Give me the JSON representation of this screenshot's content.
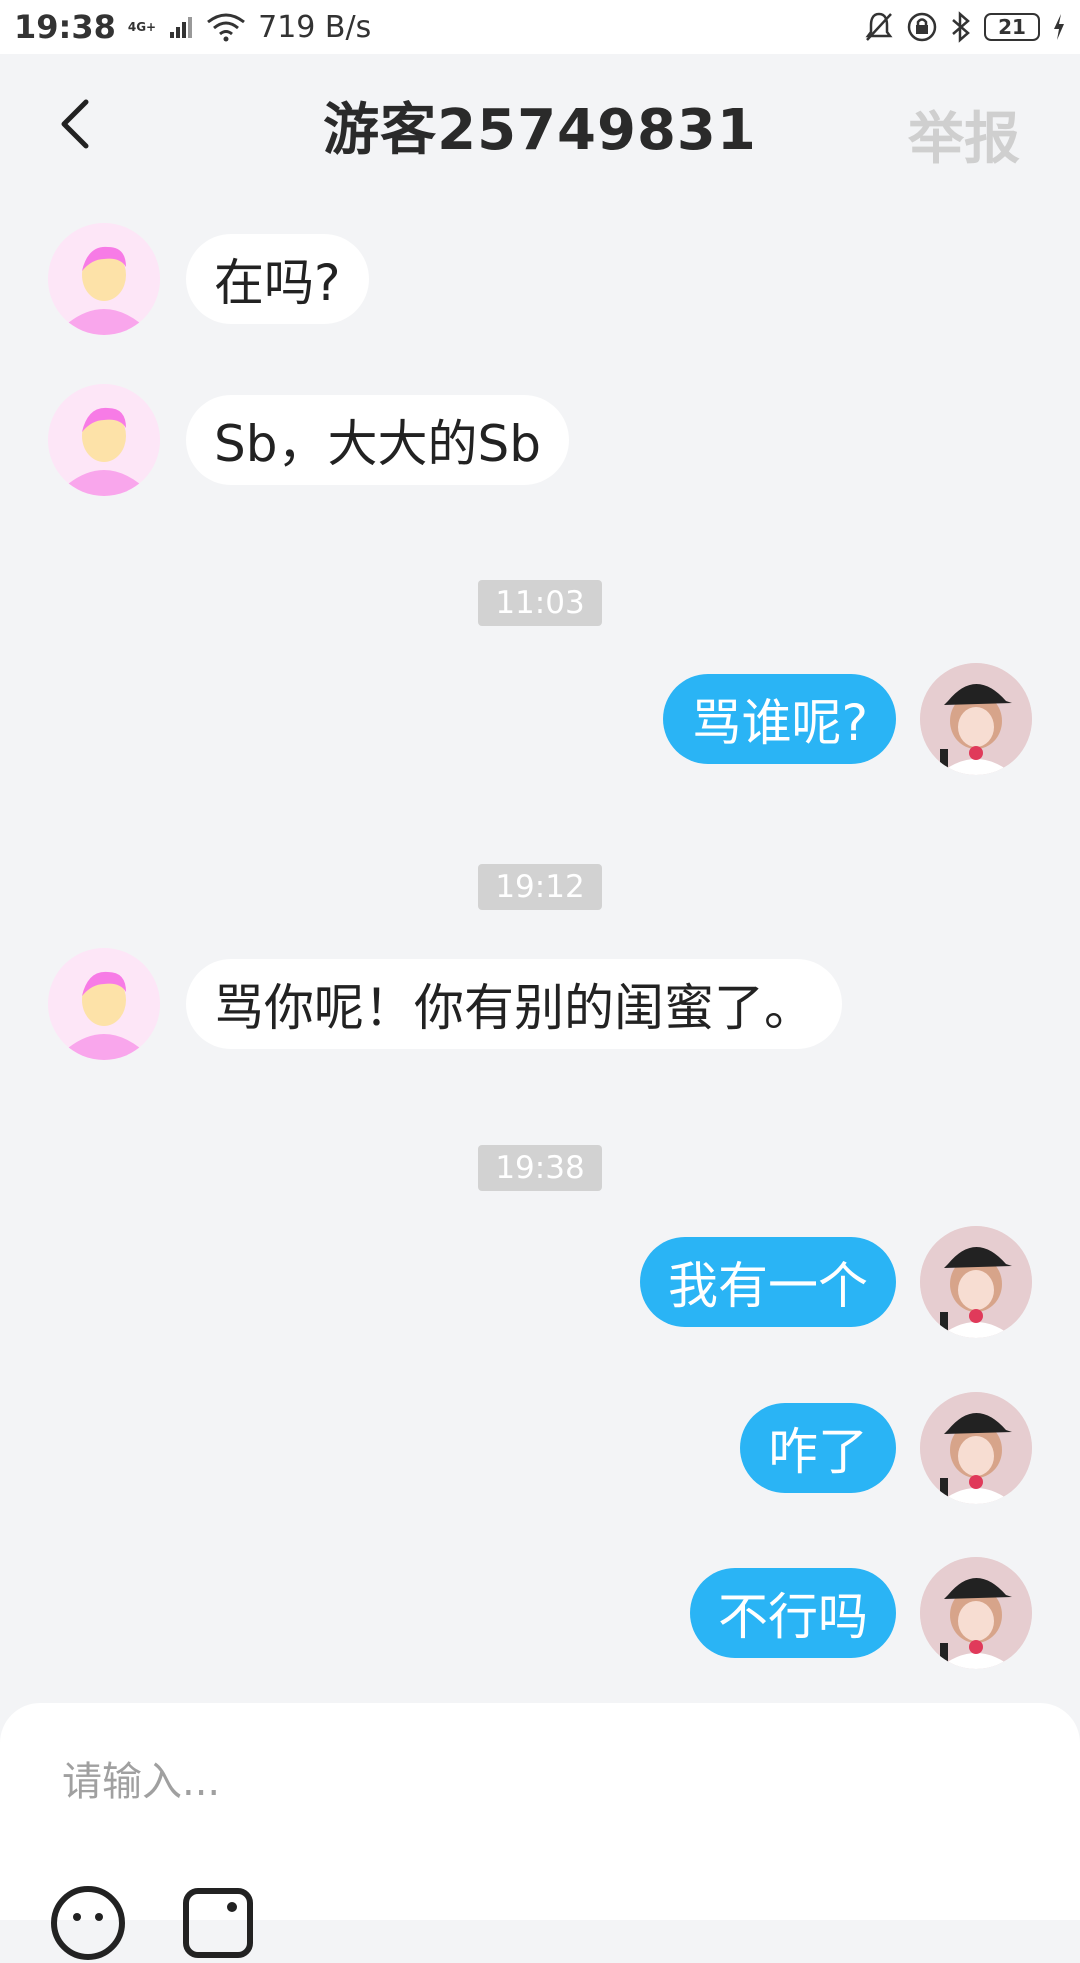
{
  "statusbar": {
    "time": "19:38",
    "network_label": "4G+",
    "speed": "719 B/s",
    "battery": "21"
  },
  "header": {
    "title": "游客25749831",
    "report_label": "举报"
  },
  "messages": [
    {
      "from": "them",
      "text": "在吗?"
    },
    {
      "from": "them",
      "text": "Sb，大大的Sb"
    },
    {
      "timestamp": "11:03"
    },
    {
      "from": "me",
      "text": "骂谁呢?"
    },
    {
      "timestamp": "19:12"
    },
    {
      "from": "them",
      "text": "骂你呢！你有别的闺蜜了。"
    },
    {
      "timestamp": "19:38"
    },
    {
      "from": "me",
      "text": "我有一个"
    },
    {
      "from": "me",
      "text": "咋了"
    },
    {
      "from": "me",
      "text": "不行吗"
    }
  ],
  "input": {
    "placeholder": "请输入..."
  },
  "colors": {
    "background": "#f3f4f6",
    "my_bubble": "#2ab4f5",
    "their_bubble": "#ffffff",
    "timestamp_bg": "#d2d2d2",
    "report": "#cfcfcf"
  }
}
